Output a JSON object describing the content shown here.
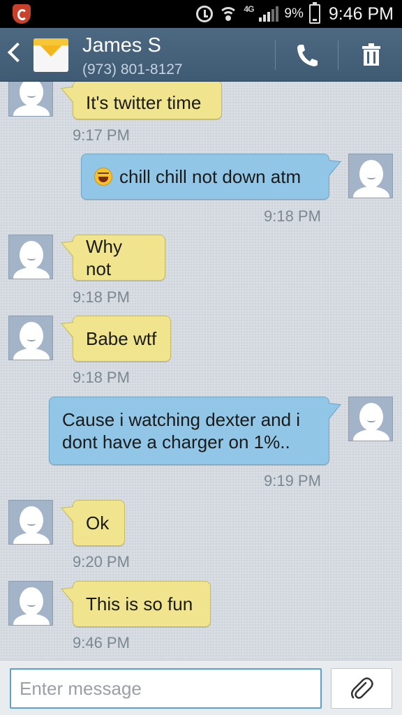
{
  "status_bar": {
    "network": "4G",
    "battery_percent": "9%",
    "time": "9:46 PM"
  },
  "header": {
    "contact_name": "James S",
    "contact_number": "(973) 801-8127",
    "icons": [
      "back-icon",
      "envelope-icon",
      "phone-icon",
      "trash-icon"
    ]
  },
  "messages": [
    {
      "direction": "in",
      "text": "It's twitter time",
      "time": "9:17 PM"
    },
    {
      "direction": "out",
      "text": "chill chill not down atm",
      "time": "9:18 PM",
      "emoji": "laughing-emoji-icon"
    },
    {
      "direction": "in",
      "text": "Why not",
      "time": "9:18 PM"
    },
    {
      "direction": "in",
      "text": "Babe wtf",
      "time": "9:18 PM"
    },
    {
      "direction": "out",
      "text": "Cause i watching dexter and i dont have a charger on 1%..",
      "time": "9:19 PM"
    },
    {
      "direction": "in",
      "text": "Ok",
      "time": "9:20 PM"
    },
    {
      "direction": "in",
      "text": "This is so fun",
      "time": "9:46 PM"
    }
  ],
  "composer": {
    "placeholder": "Enter message",
    "value": ""
  },
  "colors": {
    "incoming_bubble": "#f0e58e",
    "outgoing_bubble": "#92c6e6",
    "header": "#46627b"
  }
}
